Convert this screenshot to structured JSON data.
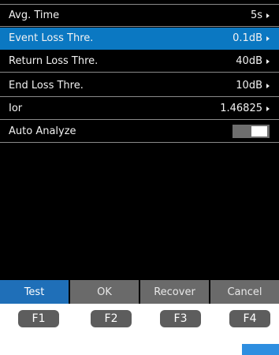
{
  "settings": [
    {
      "label": "Avg. Time",
      "value": "5s"
    },
    {
      "label": "Event Loss Thre.",
      "value": "0.1dB"
    },
    {
      "label": "Return Loss Thre.",
      "value": "40dB"
    },
    {
      "label": "End Loss Thre.",
      "value": "10dB"
    },
    {
      "label": "Ior",
      "value": "1.46825"
    },
    {
      "label": "Auto Analyze",
      "toggle_on": true
    }
  ],
  "selected_row": "Event Loss Thre.",
  "softkeys": [
    "Test",
    "OK",
    "Recover",
    "Cancel"
  ],
  "active_softkey": "Test",
  "function_keys": [
    "F1",
    "F2",
    "F3",
    "F4"
  ],
  "colors": {
    "selection": "#0b78c2",
    "softkey_active": "#1f6fb8",
    "softkey": "#6a6a6a",
    "background": "#000000"
  },
  "icons": {
    "value_arrow": "triangle-right-icon"
  }
}
